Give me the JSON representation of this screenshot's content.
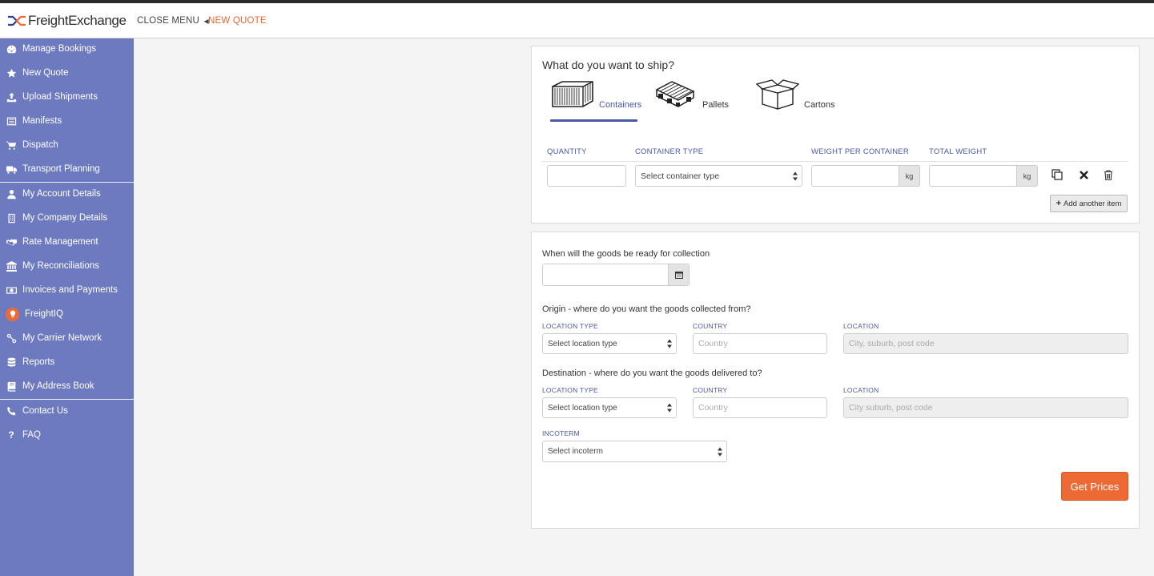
{
  "header": {
    "logo_text": "FreightExchange",
    "close_menu_label": "CLOSE MENU",
    "breadcrumb": "NEW QUOTE"
  },
  "sidebar": {
    "items": [
      {
        "label": "Manage Bookings",
        "icon": "dashboard-icon"
      },
      {
        "label": "New Quote",
        "icon": "star-icon"
      },
      {
        "label": "Upload Shipments",
        "icon": "upload-icon"
      },
      {
        "label": "Manifests",
        "icon": "list-icon"
      },
      {
        "label": "Dispatch",
        "icon": "cart-icon"
      },
      {
        "label": "Transport Planning",
        "icon": "truck-icon"
      },
      {
        "label": "My Account Details",
        "icon": "user-icon"
      },
      {
        "label": "My Company Details",
        "icon": "building-icon"
      },
      {
        "label": "Rate Management",
        "icon": "handshake-icon"
      },
      {
        "label": "My Reconciliations",
        "icon": "bank-icon"
      },
      {
        "label": "Invoices and Payments",
        "icon": "money-icon"
      },
      {
        "label": "FreightIQ",
        "icon": "lightbulb-icon"
      },
      {
        "label": "My Carrier Network",
        "icon": "network-icon"
      },
      {
        "label": "Reports",
        "icon": "database-icon"
      },
      {
        "label": "My Address Book",
        "icon": "book-icon"
      },
      {
        "label": "Contact Us",
        "icon": "phone-icon"
      },
      {
        "label": "FAQ",
        "icon": "question-icon"
      }
    ]
  },
  "ship": {
    "title": "What do you want to ship?",
    "tabs": [
      {
        "label": "Containers",
        "icon": "container-icon",
        "active": true
      },
      {
        "label": "Pallets",
        "icon": "pallet-icon",
        "active": false
      },
      {
        "label": "Cartons",
        "icon": "carton-icon",
        "active": false
      }
    ],
    "columns": {
      "quantity": "QUANTITY",
      "container_type": "CONTAINER TYPE",
      "weight_per_container": "WEIGHT PER CONTAINER",
      "total_weight": "TOTAL WEIGHT"
    },
    "row": {
      "quantity": "",
      "container_type": "Select container type",
      "weight_unit": "kg",
      "total_unit": "kg"
    },
    "add_item_label": "Add another item"
  },
  "collection": {
    "ready_label": "When will the goods be ready for collection",
    "origin_label": "Origin - where do you want the goods collected from?",
    "destination_label": "Destination - where do you want the goods delivered to?",
    "location_type_label": "LOCATION TYPE",
    "country_label": "COUNTRY",
    "location_label": "LOCATION",
    "origin": {
      "location_type": "Select location type",
      "country_placeholder": "Country",
      "location_placeholder": "City, suburb, post code"
    },
    "destination": {
      "location_type": "Select location type",
      "country_placeholder": "Country",
      "location_placeholder": "City suburb, post code"
    },
    "incoterm_label": "INCOTERM",
    "incoterm_value": "Select incoterm",
    "get_prices_label": "Get Prices"
  },
  "colors": {
    "sidebar_bg": "#6d7abf",
    "accent_blue": "#4a59a6",
    "accent_orange": "#ed6a35"
  }
}
